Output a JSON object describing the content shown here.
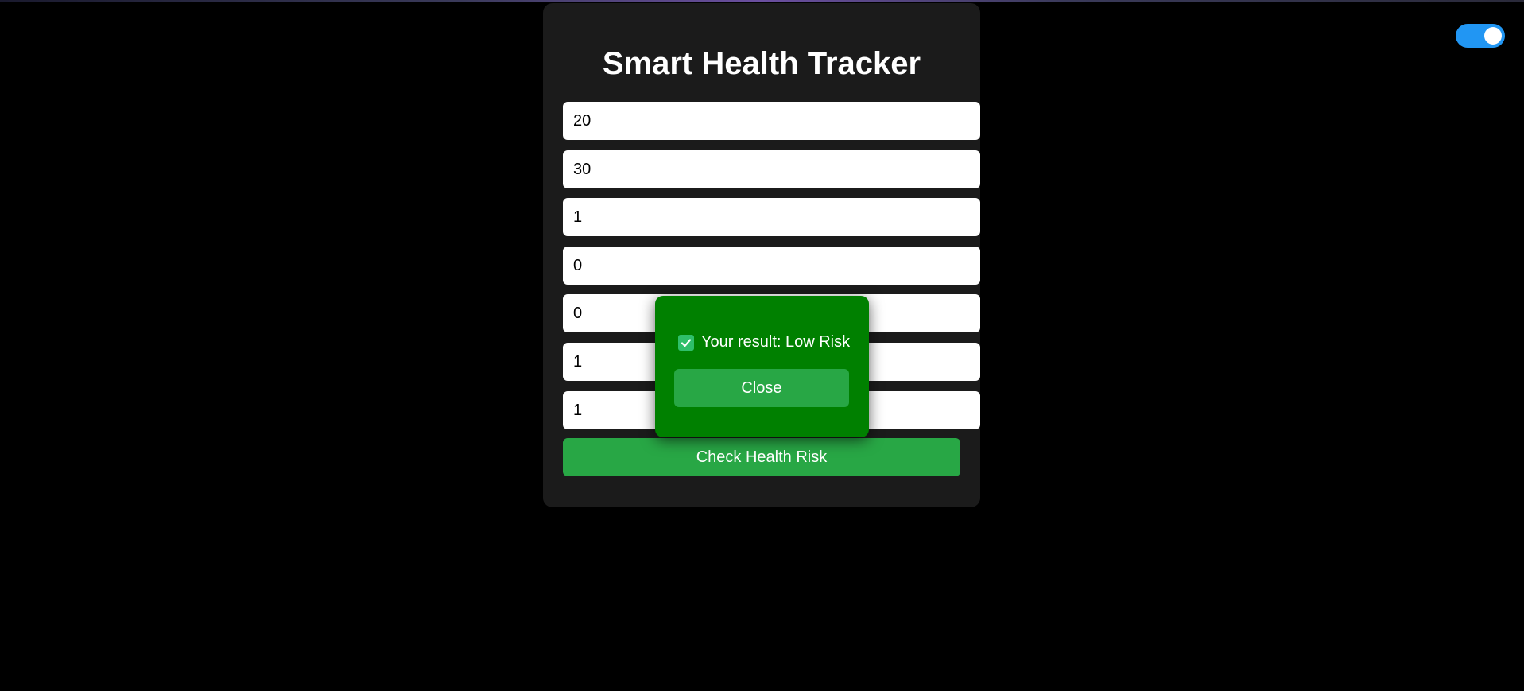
{
  "app": {
    "title": "Smart Health Tracker"
  },
  "form": {
    "fields": [
      {
        "value": "20"
      },
      {
        "value": "30"
      },
      {
        "value": "1"
      },
      {
        "value": "0"
      },
      {
        "value": "0"
      },
      {
        "value": "1"
      },
      {
        "value": "1"
      }
    ],
    "submit_label": "Check Health Risk"
  },
  "modal": {
    "icon": "check-box-icon",
    "message": "Your result: Low Risk",
    "close_label": "Close"
  },
  "theme_toggle": {
    "state": "on"
  },
  "colors": {
    "background": "#000000",
    "card": "#1b1b1b",
    "accent_green": "#28a745",
    "modal_green": "#008000",
    "toggle_blue": "#2196f3"
  }
}
